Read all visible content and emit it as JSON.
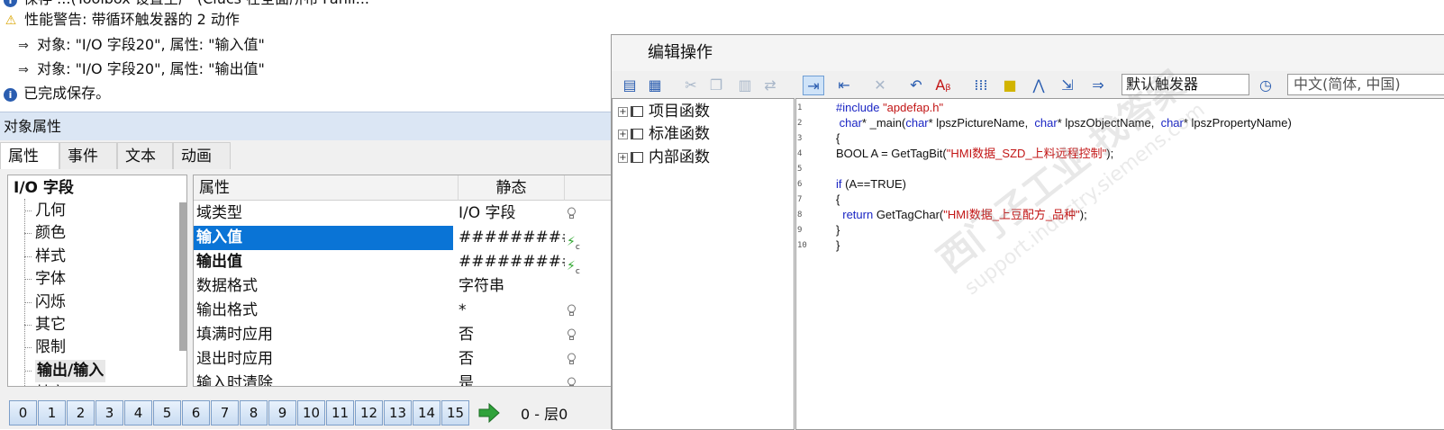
{
  "log": {
    "lines": [
      {
        "text": "保存 ...(Toolbox 设置生产 (Clucs 在全面所布 Fahli...",
        "icon": "info-icon"
      },
      {
        "text": "性能警告: 带循环触发器的 2 动作",
        "icon": "warning-icon"
      },
      {
        "text": "对象: \"I/O 字段20\", 属性: \"输入值\"",
        "icon": "arrow-icon"
      },
      {
        "text": "对象: \"I/O 字段20\", 属性: \"输出值\"",
        "icon": "arrow-icon"
      },
      {
        "text": "已完成保存。",
        "icon": "info-icon"
      }
    ]
  },
  "object_properties": {
    "title": "对象属性",
    "tabs": [
      "属性",
      "事件",
      "文本",
      "动画"
    ],
    "tree": {
      "root": "I/O 字段",
      "items": [
        "几何",
        "颜色",
        "样式",
        "字体",
        "闪烁",
        "其它",
        "限制",
        "输出/输入",
        "其它"
      ]
    },
    "grid": {
      "headers": [
        "属性",
        "静态",
        ""
      ],
      "rows": [
        {
          "name": "域类型",
          "value": "I/O 字段",
          "dyn": "bulb"
        },
        {
          "name": "输入值",
          "value": "##########",
          "dyn": "c-action"
        },
        {
          "name": "输出值",
          "value": "##########",
          "dyn": "c-action"
        },
        {
          "name": "数据格式",
          "value": "字符串",
          "dyn": "none"
        },
        {
          "name": "输出格式",
          "value": "*",
          "dyn": "bulb"
        },
        {
          "name": "填满时应用",
          "value": "否",
          "dyn": "bulb"
        },
        {
          "name": "退出时应用",
          "value": "否",
          "dyn": "bulb"
        },
        {
          "name": "输入时清除",
          "value": "是",
          "dyn": "bulb"
        }
      ]
    },
    "layers": {
      "buttons": [
        "0",
        "1",
        "2",
        "3",
        "4",
        "5",
        "6",
        "7",
        "8",
        "9",
        "10",
        "11",
        "12",
        "13",
        "14",
        "15"
      ],
      "status": "0 - 层0"
    }
  },
  "edit_action": {
    "title": "编辑操作",
    "trigger": "默认触发器",
    "language": "中文(简体, 中国)",
    "func_tree": [
      "项目函数",
      "标准函数",
      "内部函数"
    ],
    "code_lines": [
      "#include \"apdefap.h\"",
      " char* _main(char* lpszPictureName,  char* lpszObjectName,  char* lpszPropertyName)",
      "{",
      "BOOL A = GetTagBit(\"HMI数据_SZD_上料远程控制\");",
      "",
      "if (A==TRUE)",
      "{",
      "  return GetTagChar(\"HMI数据_上豆配方_品种\");",
      "}",
      "}"
    ],
    "line_numbers": [
      "1",
      "2",
      "3",
      "4",
      "5",
      "6",
      "7",
      "8",
      "9",
      "10"
    ],
    "watermark": "西门子工业 找答案",
    "watermark_url": "support.industry.siemens.com"
  },
  "colors": {
    "selection": "#0a74d6",
    "keyword": "#1a25c4",
    "string": "#c21515",
    "titlebar": "#dbe6f4"
  }
}
